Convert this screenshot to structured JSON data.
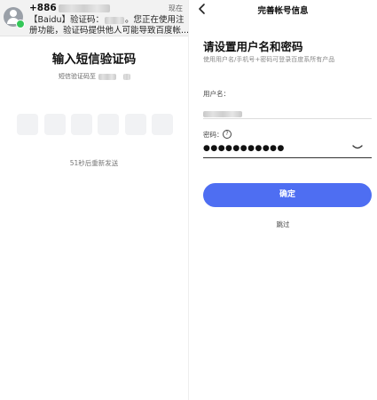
{
  "sms_screen": {
    "notification": {
      "phone_prefix": "+886",
      "time": "现在",
      "line1_start": "【Baidu】验证码：",
      "line1_end": "。您正在使用注",
      "line2": "册功能，验证码提供他人可能导致百度帐..."
    },
    "title": "输入短信验证码",
    "sent_to_label": "短信验证码至",
    "code_box_count": 6,
    "resend_text": "51秒后重新发送"
  },
  "account_screen": {
    "nav_title": "完善帐号信息",
    "title": "请设置用户名和密码",
    "subtitle": "使用用户名/手机号+密码可登录百度系所有产品",
    "username_label": "用户名：",
    "password_label": "密码：",
    "password_help_icon": "?",
    "password_value": "●●●●●●●●●●●",
    "confirm_label": "确定",
    "skip_label": "跳过",
    "accent_color": "#4e6ef2"
  }
}
